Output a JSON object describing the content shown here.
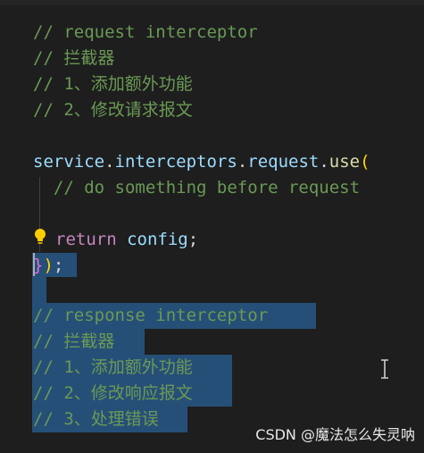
{
  "editor": {
    "lines": [
      "// request interceptor",
      "// 拦截器",
      "// 1、添加额外功能",
      "// 2、修改请求报文",
      "",
      "service.interceptors.request.use(",
      "  // do something before request",
      "",
      "return config;",
      "});",
      "",
      "// response interceptor",
      "// 拦截器",
      "// 1、添加额外功能",
      "// 2、修改响应报文",
      "// 3、处理错误"
    ],
    "code": {
      "service": "service",
      "dot1": ".",
      "interceptors": "interceptors",
      "dot2": ".",
      "request": "request",
      "dot3": ".",
      "use": "use",
      "open_paren": "(",
      "return_kw": "return",
      "config": " config",
      "semicolon": ";",
      "close_brace": "}",
      "close_paren": ")",
      "close_semi": ";"
    }
  },
  "watermark": "CSDN @魔法怎么失灵呐",
  "icons": {
    "lightbulb": "lightbulb-icon",
    "text_cursor": "ibeam-cursor-icon"
  },
  "colors": {
    "background": "#1e1e1e",
    "comment": "#6a9955",
    "selection": "#264f78",
    "keyword": "#c586c0",
    "variable": "#9cdcfe",
    "function": "#dcdcaa"
  }
}
